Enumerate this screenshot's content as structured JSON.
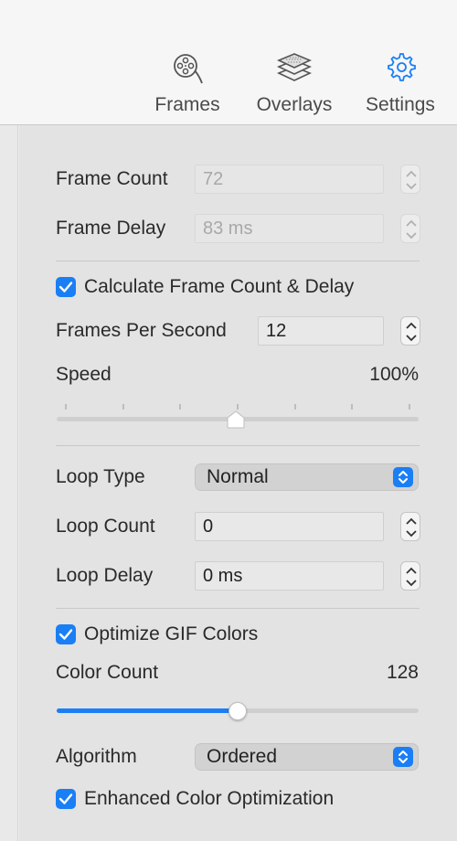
{
  "toolbar": {
    "tabs": [
      {
        "label": "Frames",
        "icon": "film-reel-icon"
      },
      {
        "label": "Overlays",
        "icon": "layers-icon"
      },
      {
        "label": "Settings",
        "icon": "gear-icon"
      }
    ],
    "active_tab": "Settings"
  },
  "settings": {
    "frame_count": {
      "label": "Frame Count",
      "value": "72",
      "enabled": false
    },
    "frame_delay": {
      "label": "Frame Delay",
      "value": "83 ms",
      "enabled": false
    },
    "calculate": {
      "label": "Calculate Frame Count & Delay",
      "checked": true
    },
    "fps": {
      "label": "Frames Per Second",
      "value": "12"
    },
    "speed": {
      "label": "Speed",
      "value": "100%",
      "level": 0.5,
      "ticks": 7
    },
    "loop_type": {
      "label": "Loop Type",
      "value": "Normal"
    },
    "loop_count": {
      "label": "Loop Count",
      "value": "0"
    },
    "loop_delay": {
      "label": "Loop Delay",
      "value": "0 ms"
    },
    "optimize": {
      "label": "Optimize GIF Colors",
      "checked": true
    },
    "color_count": {
      "label": "Color Count",
      "value": "128",
      "level": 0.5
    },
    "algorithm": {
      "label": "Algorithm",
      "value": "Ordered"
    },
    "enhanced": {
      "label": "Enhanced Color Optimization",
      "checked": true
    }
  },
  "colors": {
    "accent": "#1a7ff5",
    "panel": "#e3e3e3",
    "toolbar": "#f6f6f6",
    "settings_icon": "#1a7ff5"
  }
}
